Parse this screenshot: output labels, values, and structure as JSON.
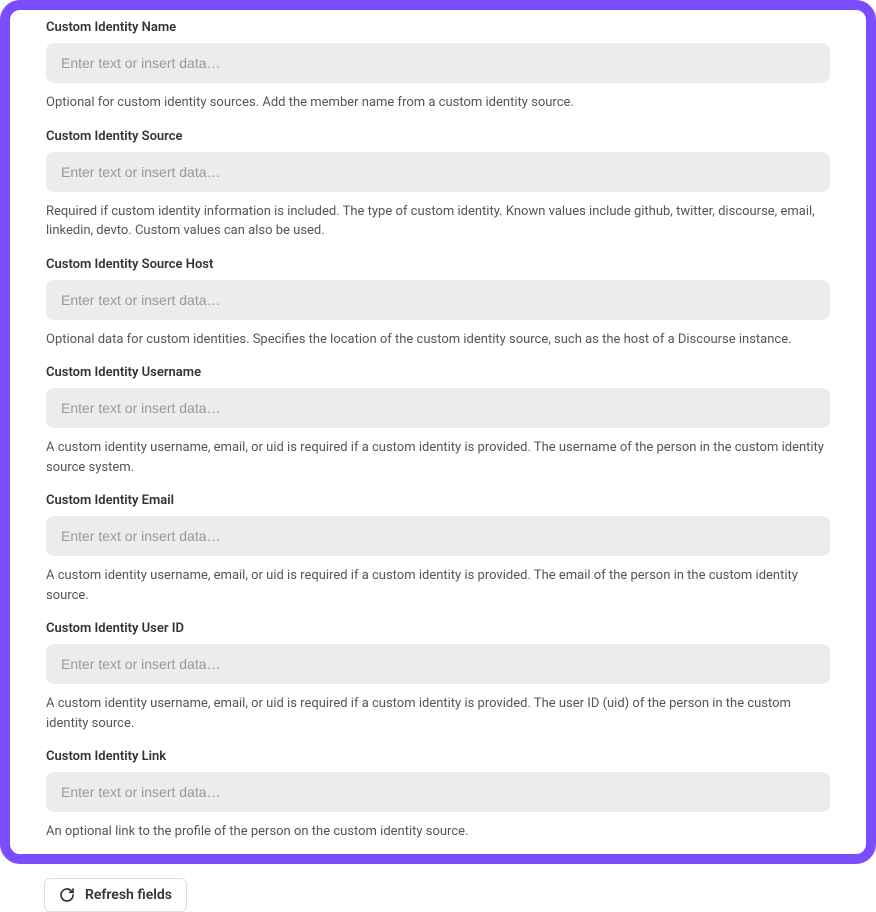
{
  "fields": [
    {
      "label": "Custom Identity Name",
      "placeholder": "Enter text or insert data…",
      "description": "Optional for custom identity sources. Add the member name from a custom identity source."
    },
    {
      "label": "Custom Identity Source",
      "placeholder": "Enter text or insert data…",
      "description": "Required if custom identity information is included. The type of custom identity. Known values include github, twitter, discourse, email, linkedin, devto. Custom values can also be used."
    },
    {
      "label": "Custom Identity Source Host",
      "placeholder": "Enter text or insert data…",
      "description": "Optional data for custom identities. Specifies the location of the custom identity source, such as the host of a Discourse instance."
    },
    {
      "label": "Custom Identity Username",
      "placeholder": "Enter text or insert data…",
      "description": "A custom identity username, email, or uid is required if a custom identity is provided. The username of the person in the custom identity source system."
    },
    {
      "label": "Custom Identity Email",
      "placeholder": "Enter text or insert data…",
      "description": "A custom identity username, email, or uid is required if a custom identity is provided. The email of the person in the custom identity source."
    },
    {
      "label": "Custom Identity User ID",
      "placeholder": "Enter text or insert data…",
      "description": "A custom identity username, email, or uid is required if a custom identity is provided. The user ID (uid) of the person in the custom identity source."
    },
    {
      "label": "Custom Identity Link",
      "placeholder": "Enter text or insert data…",
      "description": "An optional link to the profile of the person on the custom identity source."
    }
  ],
  "refresh": {
    "label": "Refresh fields"
  }
}
